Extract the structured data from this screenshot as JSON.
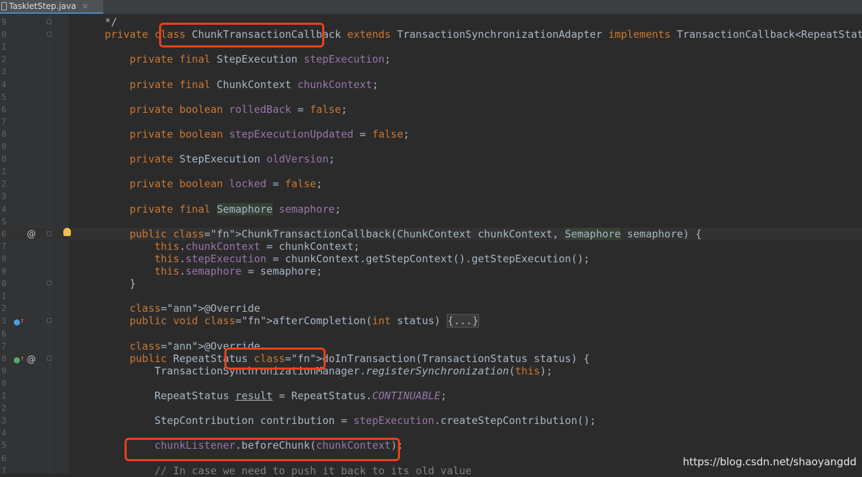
{
  "tab": {
    "title": "TaskletStep.java",
    "close": "×",
    "icon": "java-file-icon"
  },
  "lines": [
    {
      "num": "9",
      "text": "    */"
    },
    {
      "num": "0",
      "text": "    private class ChunkTransactionCallback extends TransactionSynchronizationAdapter implements TransactionCallback<RepeatStatus>"
    },
    {
      "num": "1",
      "text": ""
    },
    {
      "num": "2",
      "text": "        private final StepExecution stepExecution;"
    },
    {
      "num": "3",
      "text": ""
    },
    {
      "num": "4",
      "text": "        private final ChunkContext chunkContext;"
    },
    {
      "num": "5",
      "text": ""
    },
    {
      "num": "6",
      "text": "        private boolean rolledBack = false;"
    },
    {
      "num": "7",
      "text": ""
    },
    {
      "num": "8",
      "text": "        private boolean stepExecutionUpdated = false;"
    },
    {
      "num": "9",
      "text": ""
    },
    {
      "num": "0",
      "text": "        private StepExecution oldVersion;"
    },
    {
      "num": "1",
      "text": ""
    },
    {
      "num": "2",
      "text": "        private boolean locked = false;"
    },
    {
      "num": "3",
      "text": ""
    },
    {
      "num": "4",
      "text": "        private final Semaphore semaphore;"
    },
    {
      "num": "5",
      "text": ""
    },
    {
      "num": "6",
      "text": "        public ChunkTransactionCallback(ChunkContext chunkContext, Semaphore semaphore) {"
    },
    {
      "num": "7",
      "text": "            this.chunkContext = chunkContext;"
    },
    {
      "num": "8",
      "text": "            this.stepExecution = chunkContext.getStepContext().getStepExecution();"
    },
    {
      "num": "9",
      "text": "            this.semaphore = semaphore;"
    },
    {
      "num": "0",
      "text": "        }"
    },
    {
      "num": "1",
      "text": ""
    },
    {
      "num": "2",
      "text": "        @Override"
    },
    {
      "num": "3",
      "text": "        public void afterCompletion(int status) {...}"
    },
    {
      "num": "6",
      "text": ""
    },
    {
      "num": "7",
      "text": "        @Override"
    },
    {
      "num": "8",
      "text": "        public RepeatStatus doInTransaction(TransactionStatus status) {"
    },
    {
      "num": "9",
      "text": "            TransactionSynchronizationManager.registerSynchronization(this);"
    },
    {
      "num": "0",
      "text": ""
    },
    {
      "num": "1",
      "text": "            RepeatStatus result = RepeatStatus.CONTINUABLE;"
    },
    {
      "num": "2",
      "text": ""
    },
    {
      "num": "3",
      "text": "            StepContribution contribution = stepExecution.createStepContribution();"
    },
    {
      "num": "4",
      "text": ""
    },
    {
      "num": "5",
      "text": "            chunkListener.beforeChunk(chunkContext);"
    },
    {
      "num": "6",
      "text": ""
    },
    {
      "num": "7",
      "text": "            // In case we need to push it back to its old value"
    }
  ],
  "gutter_marks": {
    "at": "@",
    "bulb_icon": "intention-bulb-icon",
    "override_icon": "override-method-icon"
  },
  "colors": {
    "keyword": "#cc7832",
    "field": "#9876aa",
    "method": "#ffc66d",
    "annotation": "#bbb529",
    "text": "#a9b7c6",
    "highlight_box": "#e8431c"
  },
  "watermark": "https://blog.csdn.net/shaoyangdd"
}
